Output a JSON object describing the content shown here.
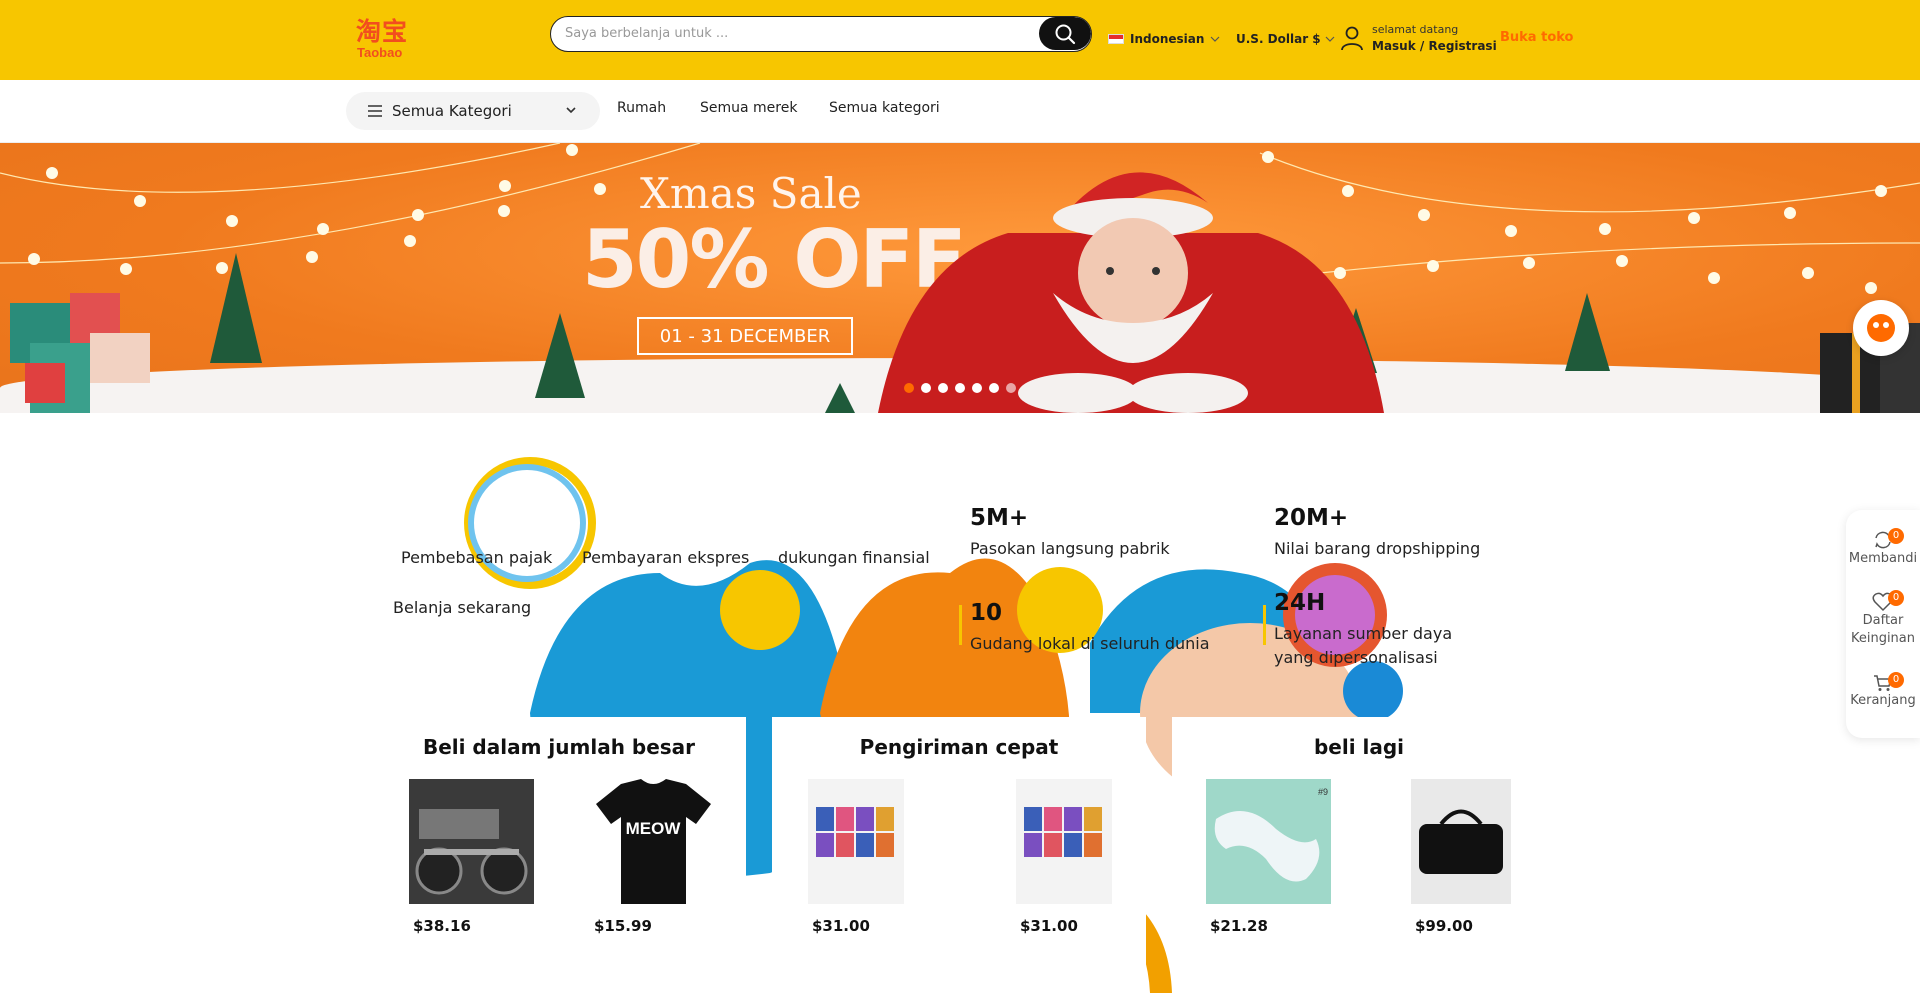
{
  "header": {
    "logo_cn": "淘宝",
    "logo_en": "Taobao",
    "search_placeholder": "Saya berbelanja untuk ...",
    "language": "Indonesian",
    "currency": "U.S. Dollar $",
    "welcome": "selamat datang",
    "login": "Masuk / Registrasi",
    "open_shop": "Buka toko"
  },
  "nav": {
    "categories_button": "Semua Kategori",
    "links": [
      "Rumah",
      "Semua merek",
      "Semua kategori"
    ]
  },
  "banner": {
    "title": "Xmas Sale",
    "headline": "50% OFF",
    "dates": "01 - 31 DECEMBER",
    "slides": 7,
    "active_slide": 1
  },
  "features": {
    "tax_free": "Pembebasan pajak",
    "express_payment": "Pembayaran ekspres",
    "financial_support": "dukungan finansial",
    "shop_now": "Belanja sekarang"
  },
  "stats": [
    {
      "value": "5M+",
      "label": "Pasokan langsung pabrik"
    },
    {
      "value": "20M+",
      "label": "Nilai barang dropshipping"
    },
    {
      "value": "10",
      "label": "Gudang lokal di seluruh dunia"
    },
    {
      "value": "24H",
      "label": "Layanan sumber daya yang dipersonalisasi"
    }
  ],
  "cards": [
    {
      "title": "Beli dalam jumlah besar",
      "products": [
        {
          "price": "$38.16"
        },
        {
          "price": "$15.99",
          "print": "MEOW"
        }
      ]
    },
    {
      "title": "Pengiriman cepat",
      "products": [
        {
          "price": "$31.00"
        },
        {
          "price": "$31.00"
        }
      ]
    },
    {
      "title": "beli lagi",
      "products": [
        {
          "price": "$21.28",
          "tag": "#9"
        },
        {
          "price": "$99.00"
        }
      ]
    }
  ],
  "sidebar": {
    "compare": "Membandi",
    "compare_count": "0",
    "wishlist_1": "Daftar",
    "wishlist_2": "Keinginan",
    "wishlist_count": "0",
    "cart": "Keranjang",
    "cart_count": "0"
  },
  "colors": {
    "brand_yellow": "#f7c600",
    "accent_orange": "#ff6a00",
    "banner_orange": "#f07a1e"
  }
}
